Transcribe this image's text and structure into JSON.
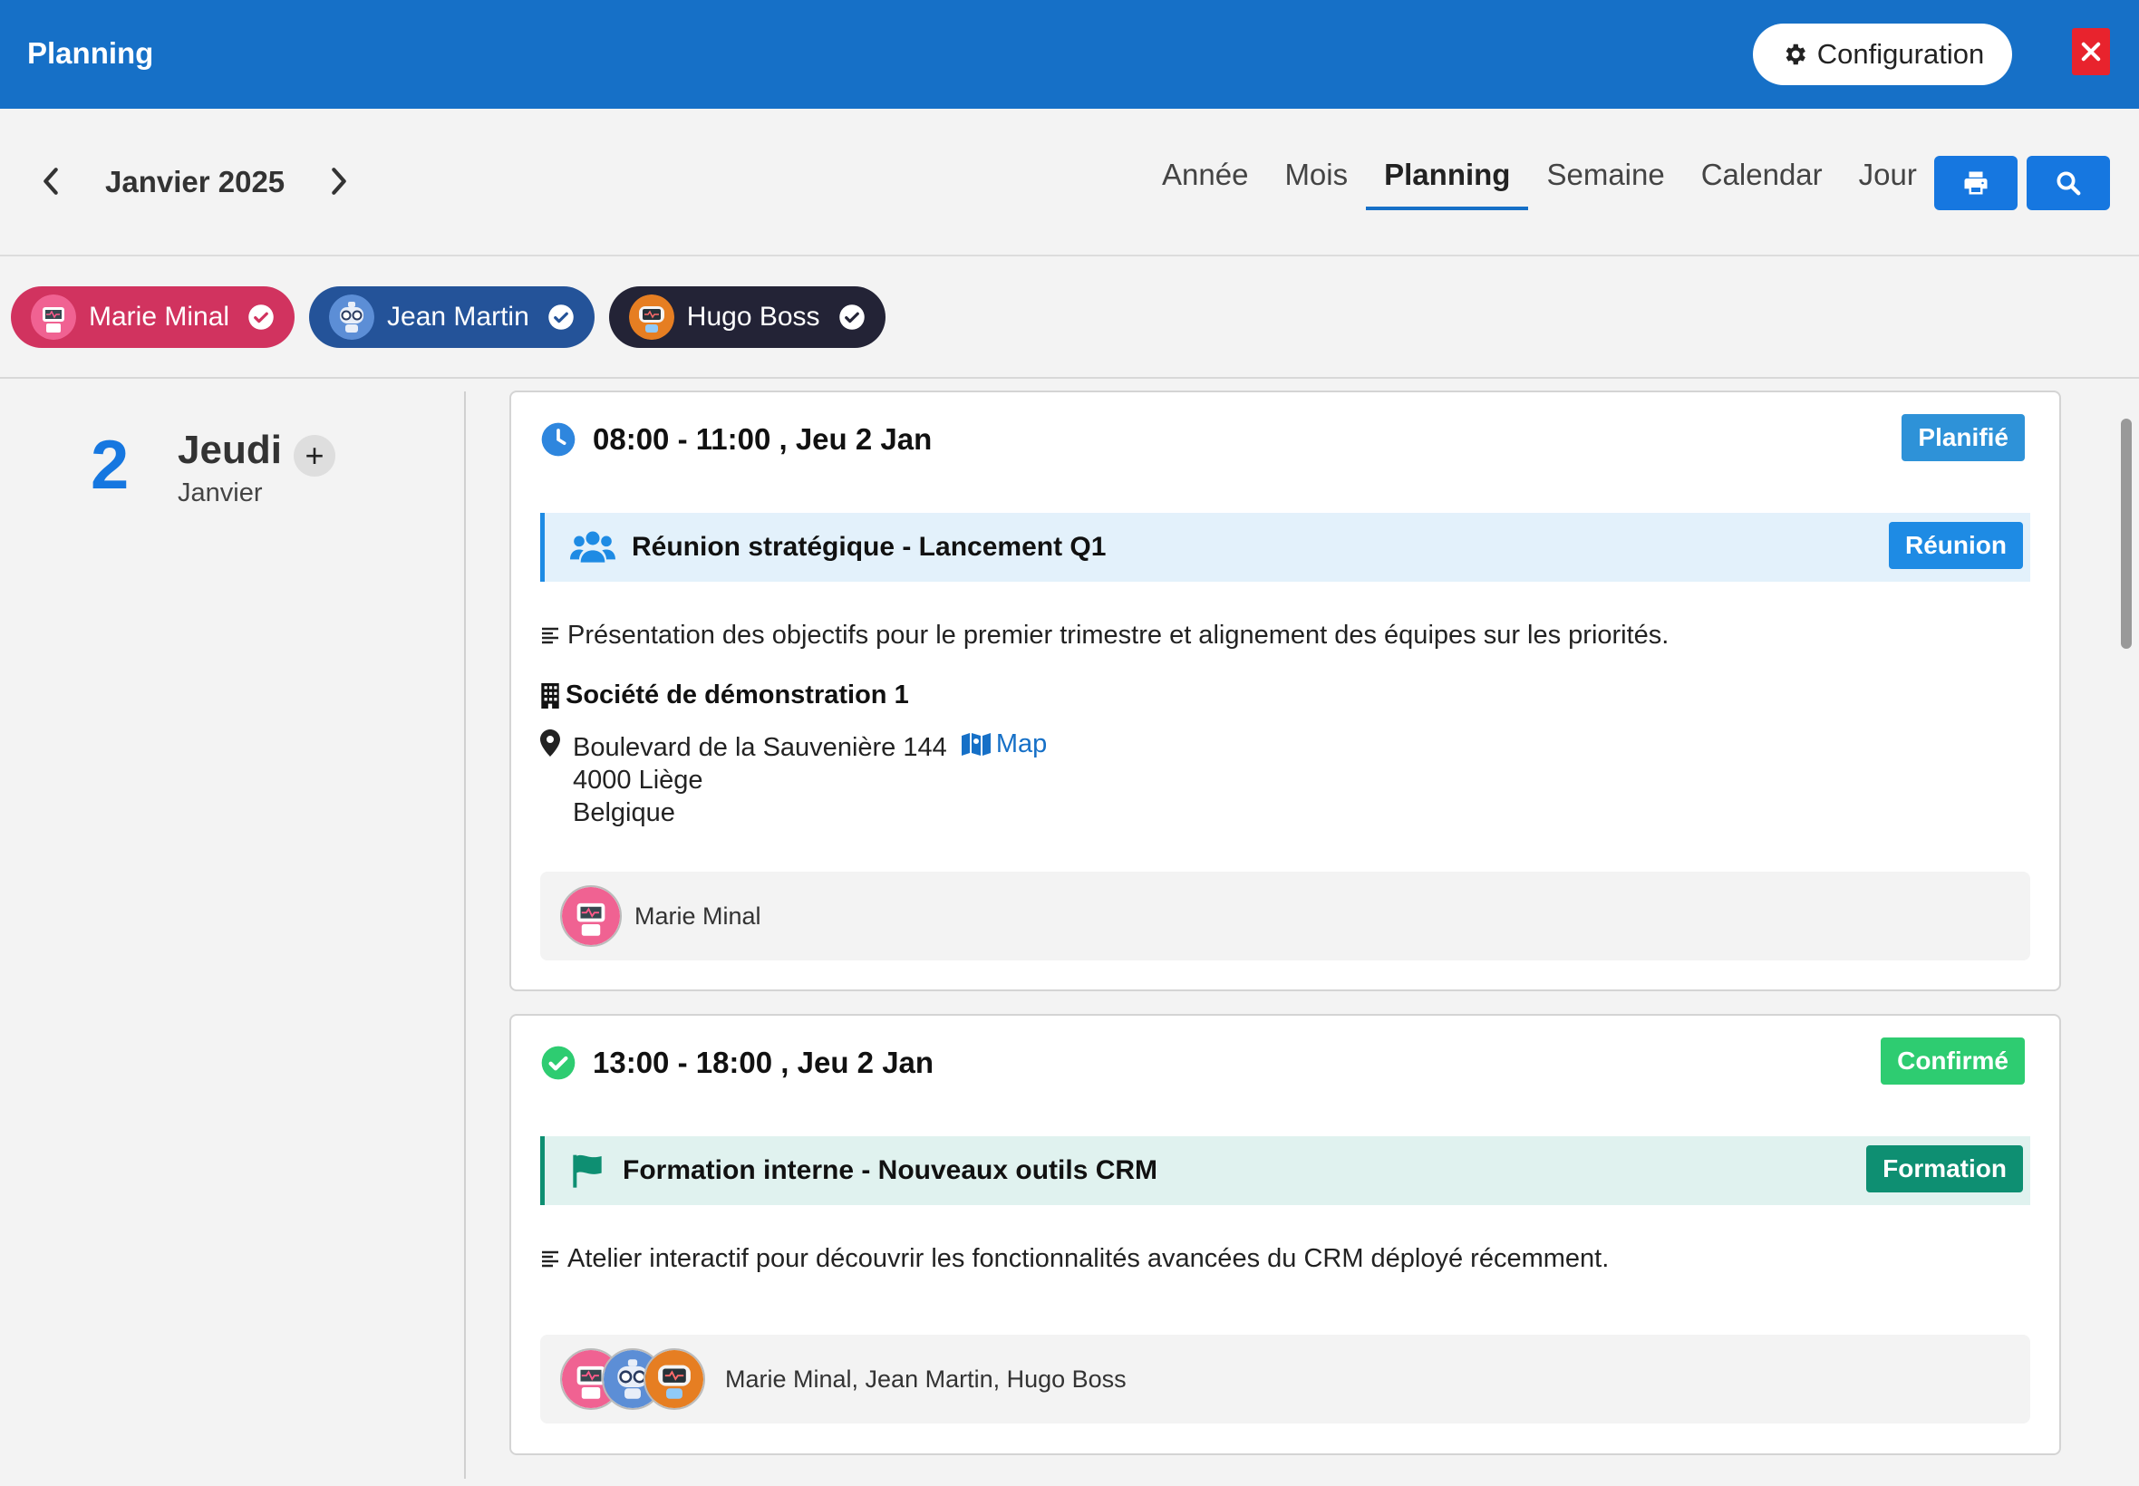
{
  "header": {
    "title": "Planning",
    "config_label": "Configuration"
  },
  "nav": {
    "month": "Janvier 2025",
    "views": [
      "Année",
      "Mois",
      "Planning",
      "Semaine",
      "Calendar",
      "Jour"
    ],
    "active_view": "Planning"
  },
  "resources": [
    {
      "name": "Marie Minal",
      "color": "#d1335f"
    },
    {
      "name": "Jean Martin",
      "color": "#245399"
    },
    {
      "name": "Hugo Boss",
      "color": "#232336"
    }
  ],
  "day": {
    "number": "2",
    "name": "Jeudi",
    "month": "Janvier",
    "add_label": "+"
  },
  "events": [
    {
      "time": "08:00 - 11:00 , Jeu 2 Jan",
      "status": "Planifié",
      "status_color": "#2e92d8",
      "title": "Réunion stratégique - Lancement Q1",
      "type": "Réunion",
      "type_color": "#1e8be4",
      "band_color": "#e3f1fb",
      "description": "Présentation des objectifs pour le premier trimestre et alignement des équipes sur les priorités.",
      "company": "Société de démonstration 1",
      "address_line1": "Boulevard de la Sauvenière 144",
      "address_line2": "4000 Liège",
      "address_line3": "Belgique",
      "map_label": "Map",
      "participants": "Marie Minal"
    },
    {
      "time": "13:00 - 18:00 , Jeu 2 Jan",
      "status": "Confirmé",
      "status_color": "#2ecc71",
      "title": "Formation interne - Nouveaux outils CRM",
      "type": "Formation",
      "type_color": "#0e8f72",
      "band_color": "#e0f2ef",
      "description": "Atelier interactif pour découvrir les fonctionnalités avancées du CRM déployé récemment.",
      "participants": "Marie Minal, Jean Martin, Hugo Boss"
    }
  ],
  "colors": {
    "primary": "#1670c7",
    "button": "#1677e0",
    "close": "#e8232d"
  }
}
